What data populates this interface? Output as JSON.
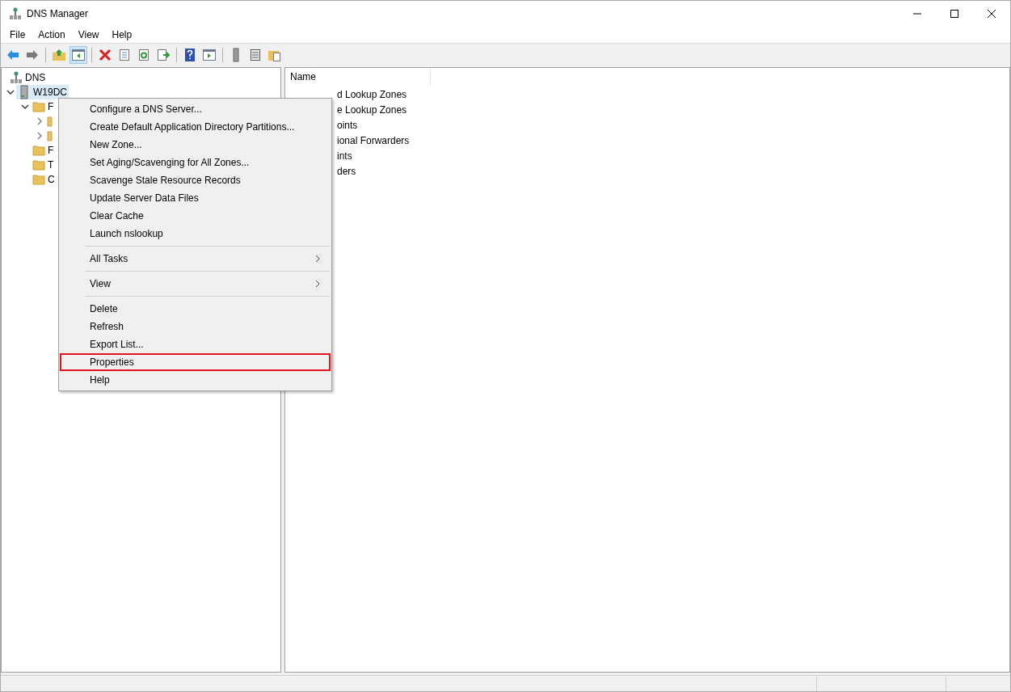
{
  "window": {
    "title": "DNS Manager"
  },
  "menu_bar": [
    "File",
    "Action",
    "View",
    "Help"
  ],
  "toolbar": [
    {
      "kind": "back",
      "pressed": false
    },
    {
      "kind": "forward",
      "pressed": false
    },
    {
      "kind": "separator"
    },
    {
      "kind": "up",
      "pressed": false
    },
    {
      "kind": "tree",
      "pressed": true
    },
    {
      "kind": "separator"
    },
    {
      "kind": "delete",
      "pressed": false
    },
    {
      "kind": "properties",
      "pressed": false
    },
    {
      "kind": "refresh",
      "pressed": false
    },
    {
      "kind": "export",
      "pressed": false
    },
    {
      "kind": "separator"
    },
    {
      "kind": "help",
      "pressed": false
    },
    {
      "kind": "console",
      "pressed": false
    },
    {
      "kind": "separator"
    },
    {
      "kind": "server",
      "pressed": false
    },
    {
      "kind": "list",
      "pressed": false
    },
    {
      "kind": "folder",
      "pressed": false
    }
  ],
  "tree": [
    {
      "label": "DNS",
      "kind": "dns",
      "selected": false,
      "children": [
        {
          "label": "W19DC",
          "kind": "server",
          "expanded": true,
          "selected": true,
          "children": [
            {
              "label": "F",
              "kind": "folder",
              "expanded": true,
              "selected": false,
              "children": [
                {
                  "kind": "zone",
                  "expanded": false,
                  "selected": false
                },
                {
                  "kind": "zone",
                  "expanded": false,
                  "selected": false
                }
              ]
            },
            {
              "label": "F",
              "kind": "folder",
              "selected": false
            },
            {
              "label": "T",
              "kind": "folder",
              "selected": false
            },
            {
              "label": "C",
              "kind": "folder",
              "selected": false
            }
          ]
        }
      ]
    }
  ],
  "list": {
    "columns": [
      "Name"
    ],
    "rows": [
      "d Lookup Zones",
      "e Lookup Zones",
      "oints",
      "ional Forwarders",
      "ints",
      "ders"
    ]
  },
  "context_menu": [
    {
      "kind": "item",
      "label": "Configure a DNS Server...",
      "submenu": false,
      "outlined": false
    },
    {
      "kind": "item",
      "label": "Create Default Application Directory Partitions...",
      "submenu": false,
      "outlined": false
    },
    {
      "kind": "item",
      "label": "New Zone...",
      "submenu": false,
      "outlined": false
    },
    {
      "kind": "item",
      "label": "Set Aging/Scavenging for All Zones...",
      "submenu": false,
      "outlined": false
    },
    {
      "kind": "item",
      "label": "Scavenge Stale Resource Records",
      "submenu": false,
      "outlined": false
    },
    {
      "kind": "item",
      "label": "Update Server Data Files",
      "submenu": false,
      "outlined": false
    },
    {
      "kind": "item",
      "label": "Clear Cache",
      "submenu": false,
      "outlined": false
    },
    {
      "kind": "item",
      "label": "Launch nslookup",
      "submenu": false,
      "outlined": false
    },
    {
      "kind": "separator"
    },
    {
      "kind": "item",
      "label": "All Tasks",
      "submenu": true,
      "outlined": false
    },
    {
      "kind": "separator"
    },
    {
      "kind": "item",
      "label": "View",
      "submenu": true,
      "outlined": false
    },
    {
      "kind": "separator"
    },
    {
      "kind": "item",
      "label": "Delete",
      "submenu": false,
      "outlined": false
    },
    {
      "kind": "item",
      "label": "Refresh",
      "submenu": false,
      "outlined": false
    },
    {
      "kind": "item",
      "label": "Export List...",
      "submenu": false,
      "outlined": false
    },
    {
      "kind": "item",
      "label": "Properties",
      "submenu": false,
      "outlined": true
    },
    {
      "kind": "item",
      "label": "Help",
      "submenu": false,
      "outlined": false
    }
  ]
}
